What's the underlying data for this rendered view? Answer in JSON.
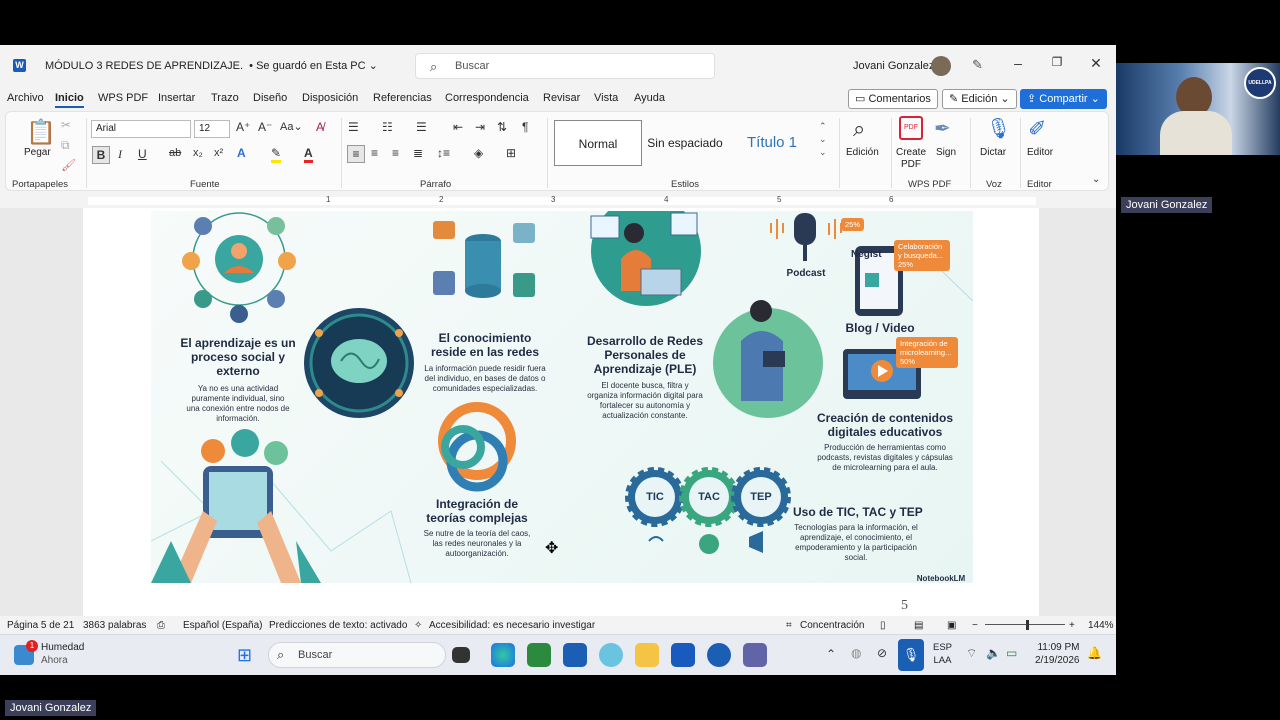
{
  "window": {
    "title": "MÓDULO 3  REDES DE APRENDIZAJE.",
    "save_status": "• Se guardó en Esta PC",
    "search_placeholder": "Buscar",
    "user_name": "Jovani  Gonzalez"
  },
  "menu": {
    "items": [
      "Archivo",
      "Inicio",
      "WPS PDF",
      "Insertar",
      "Trazo",
      "Diseño",
      "Disposición",
      "Referencias",
      "Correspondencia",
      "Revisar",
      "Vista",
      "Ayuda"
    ],
    "active": "Inicio",
    "comments_label": "Comentarios",
    "edit_label": "Edición",
    "share_label": "Compartir"
  },
  "ribbon": {
    "paste_label": "Pegar",
    "clipboard_label": "Portapapeles",
    "font_name": "Arial",
    "font_size": "12",
    "font_group_label": "Fuente",
    "paragraph_label": "Párrafo",
    "styles": [
      "Normal",
      "Sin espaciado",
      "Título 1"
    ],
    "styles_label": "Estilos",
    "edicion_label": "Edición",
    "create_pdf_label": "Create PDF",
    "sign_label": "Sign",
    "wps_pdf_label": "WPS PDF",
    "dictar_label": "Dictar",
    "voz_label": "Voz",
    "editor_label": "Editor",
    "editor_group_label": "Editor"
  },
  "ruler": {
    "numbers": [
      "1",
      "2",
      "3",
      "4",
      "5",
      "6"
    ]
  },
  "infographic": {
    "t1": "El aprendizaje es un proceso social y externo",
    "s1": "Ya no es una actividad puramente individual, sino una conexión entre nodos de información.",
    "t2": "El conocimiento reside en las redes",
    "s2": "La información puede residir fuera del individuo, en bases de datos o comunidades especializadas.",
    "t3": "Desarrollo de Redes Personales de Aprendizaje (PLE)",
    "s3": "El docente busca, filtra y organiza información digital para fortalecer su autonomía y actualización constante.",
    "t4": "Integración de teorías complejas",
    "s4": "Se nutre de la teoría del caos, las redes neuronales y la autoorganización.",
    "podcast": "Podcast",
    "tag_podcast": "25%",
    "blog": "Blog / Video",
    "negist": "Negist",
    "tag_blog": "Celaboración y busqueda...",
    "tag_blog_pct": "25%",
    "tag_micro": "Integración de microlearning...",
    "tag_micro_pct": "50%",
    "t5": "Creación de contenidos digitales educativos",
    "s5": "Producción de herramientas como podcasts, revistas digitales y cápsulas de microlearning para el aula.",
    "tic": "TIC",
    "tac": "TAC",
    "tep": "TEP",
    "t6": "Uso de TIC, TAC y TEP",
    "s6": "Tecnologías para la información, el aprendizaje, el conocimiento, el empoderamiento y la participación social.",
    "brand": "NotebookLM"
  },
  "page_number": "5",
  "status": {
    "page": "Página 5 de 21",
    "words": "3863 palabras",
    "language": "Español (España)",
    "predictions": "Predicciones de texto: activado",
    "accessibility": "Accesibilidad: es necesario investigar",
    "focus": "Concentración",
    "zoom": "144%"
  },
  "taskbar": {
    "weather_title": "Humedad",
    "weather_sub": "Ahora",
    "weather_badge": "1",
    "search": "Buscar",
    "lang_top": "ESP",
    "lang_bottom": "LAA",
    "time": "11:09 PM",
    "date": "2/19/2026"
  },
  "meeting": {
    "name_right": "Jovani  Gonzalez",
    "name_bottom": "Jovani  Gonzalez",
    "logo_text": "UDELLPA"
  }
}
